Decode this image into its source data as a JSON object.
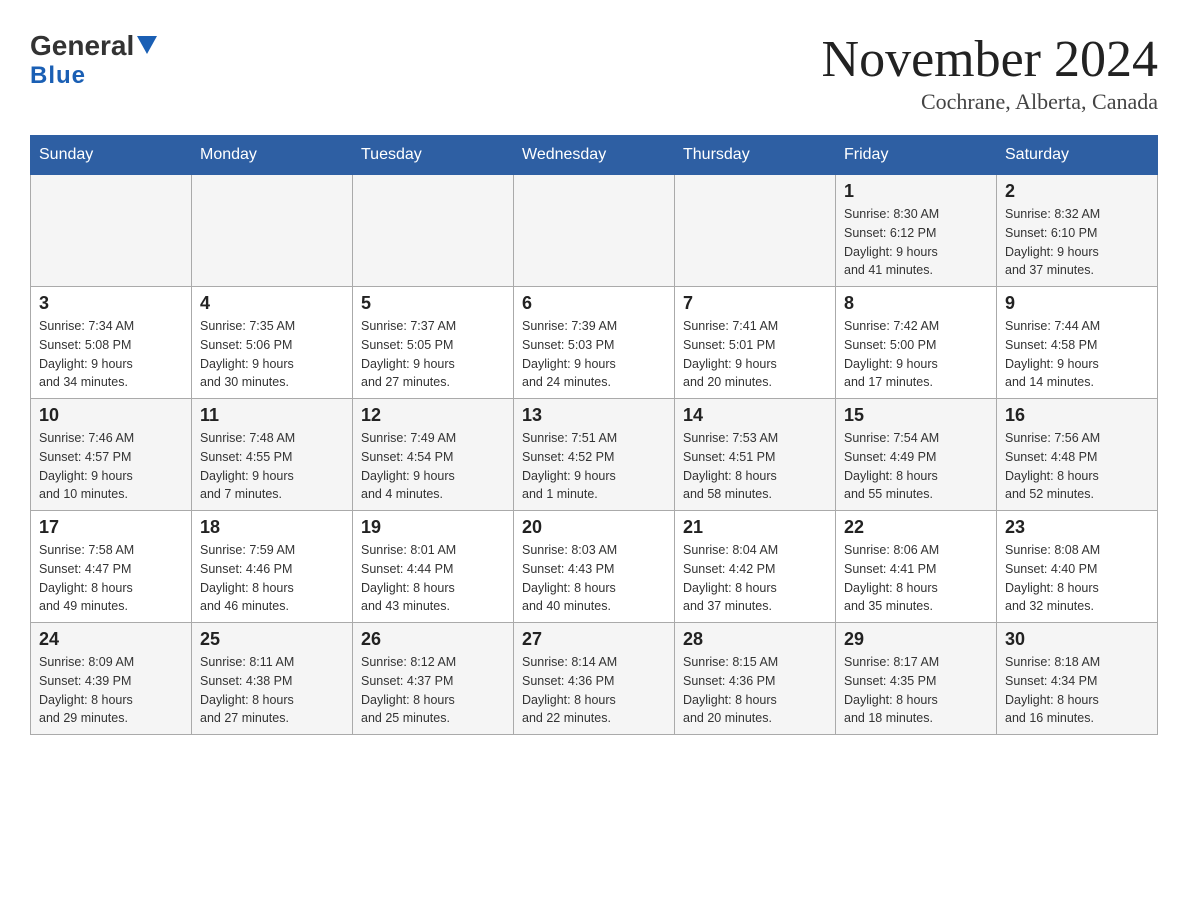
{
  "header": {
    "logo_general": "General",
    "logo_blue": "Blue",
    "month_title": "November 2024",
    "location": "Cochrane, Alberta, Canada"
  },
  "weekdays": [
    "Sunday",
    "Monday",
    "Tuesday",
    "Wednesday",
    "Thursday",
    "Friday",
    "Saturday"
  ],
  "weeks": [
    [
      {
        "day": "",
        "info": ""
      },
      {
        "day": "",
        "info": ""
      },
      {
        "day": "",
        "info": ""
      },
      {
        "day": "",
        "info": ""
      },
      {
        "day": "",
        "info": ""
      },
      {
        "day": "1",
        "info": "Sunrise: 8:30 AM\nSunset: 6:12 PM\nDaylight: 9 hours\nand 41 minutes."
      },
      {
        "day": "2",
        "info": "Sunrise: 8:32 AM\nSunset: 6:10 PM\nDaylight: 9 hours\nand 37 minutes."
      }
    ],
    [
      {
        "day": "3",
        "info": "Sunrise: 7:34 AM\nSunset: 5:08 PM\nDaylight: 9 hours\nand 34 minutes."
      },
      {
        "day": "4",
        "info": "Sunrise: 7:35 AM\nSunset: 5:06 PM\nDaylight: 9 hours\nand 30 minutes."
      },
      {
        "day": "5",
        "info": "Sunrise: 7:37 AM\nSunset: 5:05 PM\nDaylight: 9 hours\nand 27 minutes."
      },
      {
        "day": "6",
        "info": "Sunrise: 7:39 AM\nSunset: 5:03 PM\nDaylight: 9 hours\nand 24 minutes."
      },
      {
        "day": "7",
        "info": "Sunrise: 7:41 AM\nSunset: 5:01 PM\nDaylight: 9 hours\nand 20 minutes."
      },
      {
        "day": "8",
        "info": "Sunrise: 7:42 AM\nSunset: 5:00 PM\nDaylight: 9 hours\nand 17 minutes."
      },
      {
        "day": "9",
        "info": "Sunrise: 7:44 AM\nSunset: 4:58 PM\nDaylight: 9 hours\nand 14 minutes."
      }
    ],
    [
      {
        "day": "10",
        "info": "Sunrise: 7:46 AM\nSunset: 4:57 PM\nDaylight: 9 hours\nand 10 minutes."
      },
      {
        "day": "11",
        "info": "Sunrise: 7:48 AM\nSunset: 4:55 PM\nDaylight: 9 hours\nand 7 minutes."
      },
      {
        "day": "12",
        "info": "Sunrise: 7:49 AM\nSunset: 4:54 PM\nDaylight: 9 hours\nand 4 minutes."
      },
      {
        "day": "13",
        "info": "Sunrise: 7:51 AM\nSunset: 4:52 PM\nDaylight: 9 hours\nand 1 minute."
      },
      {
        "day": "14",
        "info": "Sunrise: 7:53 AM\nSunset: 4:51 PM\nDaylight: 8 hours\nand 58 minutes."
      },
      {
        "day": "15",
        "info": "Sunrise: 7:54 AM\nSunset: 4:49 PM\nDaylight: 8 hours\nand 55 minutes."
      },
      {
        "day": "16",
        "info": "Sunrise: 7:56 AM\nSunset: 4:48 PM\nDaylight: 8 hours\nand 52 minutes."
      }
    ],
    [
      {
        "day": "17",
        "info": "Sunrise: 7:58 AM\nSunset: 4:47 PM\nDaylight: 8 hours\nand 49 minutes."
      },
      {
        "day": "18",
        "info": "Sunrise: 7:59 AM\nSunset: 4:46 PM\nDaylight: 8 hours\nand 46 minutes."
      },
      {
        "day": "19",
        "info": "Sunrise: 8:01 AM\nSunset: 4:44 PM\nDaylight: 8 hours\nand 43 minutes."
      },
      {
        "day": "20",
        "info": "Sunrise: 8:03 AM\nSunset: 4:43 PM\nDaylight: 8 hours\nand 40 minutes."
      },
      {
        "day": "21",
        "info": "Sunrise: 8:04 AM\nSunset: 4:42 PM\nDaylight: 8 hours\nand 37 minutes."
      },
      {
        "day": "22",
        "info": "Sunrise: 8:06 AM\nSunset: 4:41 PM\nDaylight: 8 hours\nand 35 minutes."
      },
      {
        "day": "23",
        "info": "Sunrise: 8:08 AM\nSunset: 4:40 PM\nDaylight: 8 hours\nand 32 minutes."
      }
    ],
    [
      {
        "day": "24",
        "info": "Sunrise: 8:09 AM\nSunset: 4:39 PM\nDaylight: 8 hours\nand 29 minutes."
      },
      {
        "day": "25",
        "info": "Sunrise: 8:11 AM\nSunset: 4:38 PM\nDaylight: 8 hours\nand 27 minutes."
      },
      {
        "day": "26",
        "info": "Sunrise: 8:12 AM\nSunset: 4:37 PM\nDaylight: 8 hours\nand 25 minutes."
      },
      {
        "day": "27",
        "info": "Sunrise: 8:14 AM\nSunset: 4:36 PM\nDaylight: 8 hours\nand 22 minutes."
      },
      {
        "day": "28",
        "info": "Sunrise: 8:15 AM\nSunset: 4:36 PM\nDaylight: 8 hours\nand 20 minutes."
      },
      {
        "day": "29",
        "info": "Sunrise: 8:17 AM\nSunset: 4:35 PM\nDaylight: 8 hours\nand 18 minutes."
      },
      {
        "day": "30",
        "info": "Sunrise: 8:18 AM\nSunset: 4:34 PM\nDaylight: 8 hours\nand 16 minutes."
      }
    ]
  ]
}
